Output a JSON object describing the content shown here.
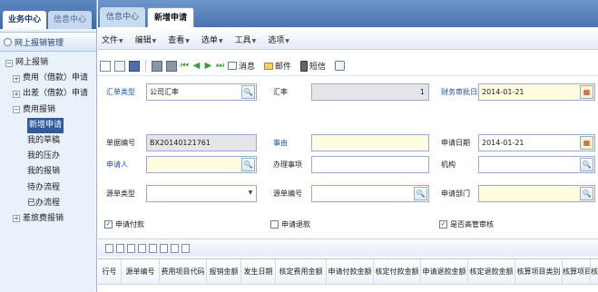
{
  "sidebar": {
    "tabs": [
      {
        "label": "业务中心",
        "active": true
      },
      {
        "label": "信息中心",
        "active": false
      }
    ],
    "header": "网上报销管理",
    "tree": [
      {
        "label": "网上报销",
        "level": 0,
        "toggle": "⊟"
      },
      {
        "label": "费用（借款）申请",
        "level": 1,
        "toggle": "⊞"
      },
      {
        "label": "出差（借款）申请",
        "level": 1,
        "toggle": "⊞"
      },
      {
        "label": "费用报销",
        "level": 1,
        "toggle": "⊟"
      },
      {
        "label": "新增申请",
        "level": 2,
        "selected": true
      },
      {
        "label": "我的草稿",
        "level": 2
      },
      {
        "label": "我的压办",
        "level": 2
      },
      {
        "label": "我的报销",
        "level": 2
      },
      {
        "label": "待办流程",
        "level": 2
      },
      {
        "label": "已办流程",
        "level": 2
      },
      {
        "label": "差旅费报销",
        "level": 1,
        "toggle": "⊞"
      }
    ]
  },
  "top_tabs": [
    {
      "label": "信息中心",
      "active": false
    },
    {
      "label": "新增申请",
      "active": true
    }
  ],
  "menu": [
    "文件",
    "编辑",
    "查看",
    "选单",
    "工具",
    "选项"
  ],
  "toolbar": {
    "message_label": "消息",
    "mail_label": "邮件",
    "sms_label": "短信"
  },
  "form": {
    "doc_type": {
      "label": "汇单类型",
      "value": "公司汇率"
    },
    "rate": {
      "label": "汇率",
      "value": "1"
    },
    "pay_date": {
      "label": "财务审批日期",
      "value": "2014-01-21"
    },
    "bill_no": {
      "label": "单据编号",
      "value": "BX20140121761"
    },
    "reason": {
      "label": "事由",
      "value": ""
    },
    "apply_date": {
      "label": "申请日期",
      "value": "2014-01-21"
    },
    "applicant": {
      "label": "申请人",
      "value": ""
    },
    "handle_item": {
      "label": "办理事项",
      "value": ""
    },
    "org": {
      "label": "机构",
      "value": ""
    },
    "source_type": {
      "label": "源单类型",
      "value": ""
    },
    "source_no": {
      "label": "源单编号",
      "value": ""
    },
    "apply_dept": {
      "label": "申请部门",
      "value": ""
    },
    "checks": [
      {
        "label": "申请付款",
        "checked": true
      },
      {
        "label": "申请退款",
        "checked": false
      },
      {
        "label": "是否高管审核",
        "checked": true
      }
    ]
  },
  "grid": {
    "columns": [
      "行号",
      "源单编号",
      "费用项目代码",
      "报销金额",
      "发生日期",
      "核定费用金额",
      "申请付款金额",
      "核定付款金额",
      "申请退款金额",
      "核定退款金额",
      "核算项目类别",
      "核算项目",
      "核"
    ]
  }
}
